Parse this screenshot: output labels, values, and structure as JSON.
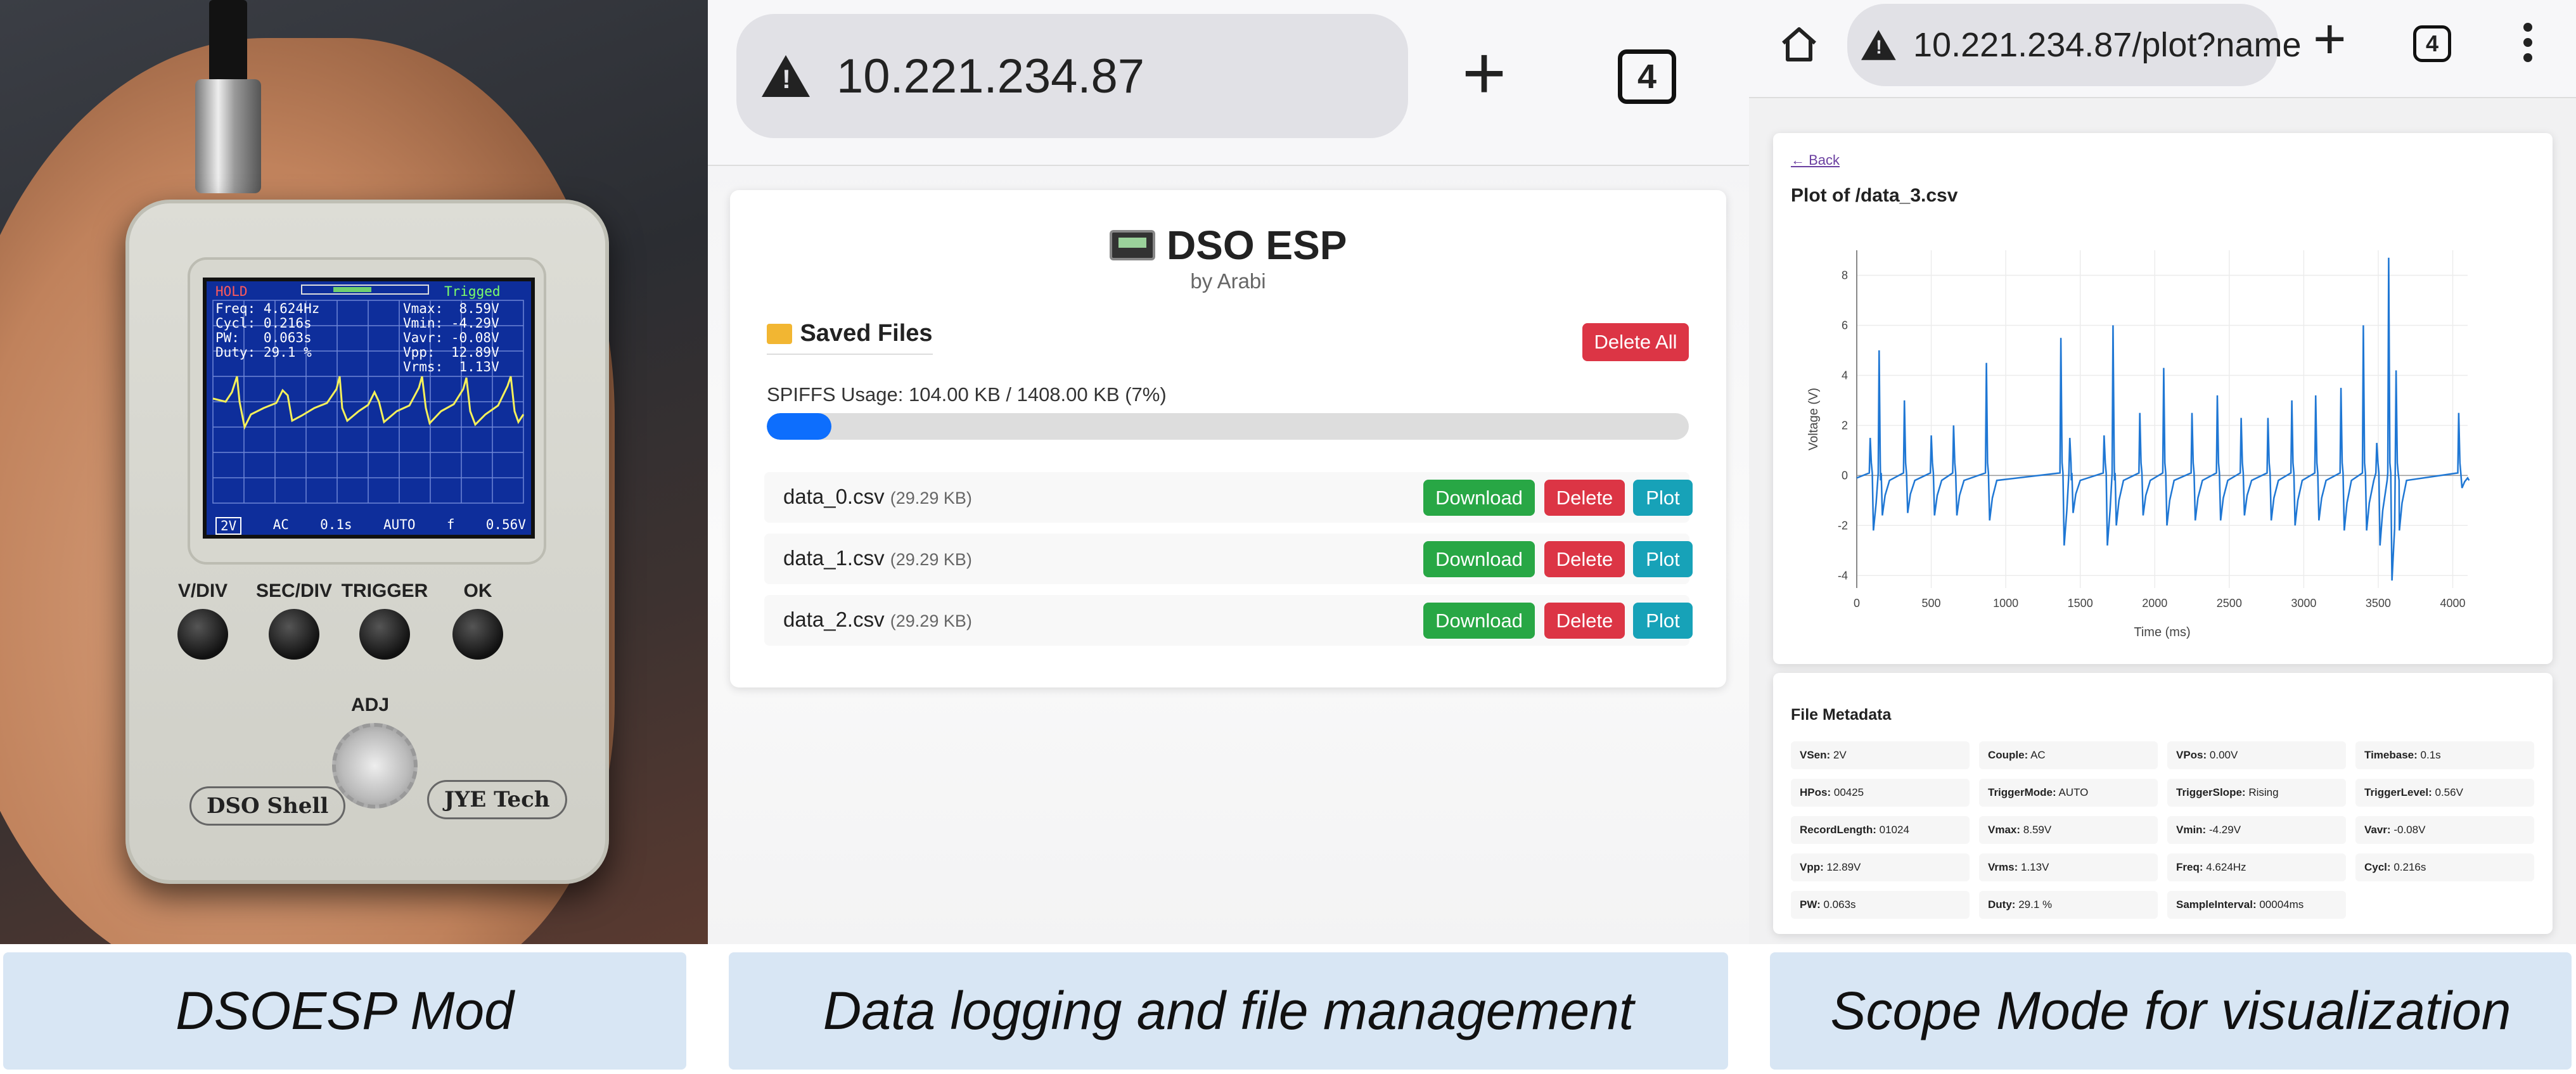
{
  "captions": {
    "left": "DSOESP Mod",
    "middle": "Data logging and file management",
    "right": "Scope Mode for visualization"
  },
  "device": {
    "hold": "HOLD",
    "trig_status": "Trigged",
    "lines_left": [
      "Freq: 4.624Hz",
      "Cycl: 0.216s",
      "PW:   0.063s",
      "Duty: 29.1 %"
    ],
    "lines_right": [
      "Vmax:  8.59V",
      "Vmin: -4.29V",
      "Vavr: -0.08V",
      "Vpp:  12.89V",
      "Vrms:  1.13V"
    ],
    "status_bar": [
      "2V",
      "AC",
      "0.1s",
      "AUTO",
      "f",
      "0.56V"
    ],
    "buttons": [
      "V/DIV",
      "SEC/DIV",
      "TRIGGER",
      "OK"
    ],
    "adj_label": "ADJ",
    "brand_left": "DSO Shell",
    "brand_right": "JYE Tech"
  },
  "browser_mid": {
    "url": "10.221.234.87",
    "tab_count": "4",
    "title": "DSO ESP",
    "subtitle": "by Arabi",
    "section": "Saved Files",
    "delete_all": "Delete All",
    "usage": "SPIFFS Usage: 104.00 KB / 1408.00 KB (7%)",
    "usage_fraction": 0.07,
    "files": [
      {
        "name": "data_0.csv",
        "size": "(29.29 KB)"
      },
      {
        "name": "data_1.csv",
        "size": "(29.29 KB)"
      },
      {
        "name": "data_2.csv",
        "size": "(29.29 KB)"
      }
    ],
    "download_label": "Download",
    "delete_label": "Delete",
    "plot_label": "Plot"
  },
  "browser_right": {
    "url": "10.221.234.87/plot?name",
    "tab_count": "4",
    "back": "← Back",
    "plot_title": "Plot of /data_3.csv",
    "metadata_title": "File Metadata",
    "metadata": [
      [
        "VSen:",
        "2V"
      ],
      [
        "Couple:",
        "AC"
      ],
      [
        "VPos:",
        "0.00V"
      ],
      [
        "Timebase:",
        "0.1s"
      ],
      [
        "HPos:",
        "00425"
      ],
      [
        "TriggerMode:",
        "AUTO"
      ],
      [
        "TriggerSlope:",
        "Rising"
      ],
      [
        "TriggerLevel:",
        "0.56V"
      ],
      [
        "RecordLength:",
        "01024"
      ],
      [
        "Vmax:",
        "8.59V"
      ],
      [
        "Vmin:",
        "-4.29V"
      ],
      [
        "Vavr:",
        "-0.08V"
      ],
      [
        "Vpp:",
        "12.89V"
      ],
      [
        "Vrms:",
        "1.13V"
      ],
      [
        "Freq:",
        "4.624Hz"
      ],
      [
        "Cycl:",
        "0.216s"
      ],
      [
        "PW:",
        "0.063s"
      ],
      [
        "Duty:",
        "29.1 %"
      ],
      [
        "SampleInterval:",
        "00004ms"
      ]
    ]
  },
  "chart_data": {
    "type": "line",
    "xlabel": "Time (ms)",
    "ylabel": "Voltage (V)",
    "xlim": [
      0,
      4100
    ],
    "ylim": [
      -4.5,
      9
    ],
    "xticks": [
      0,
      500,
      1000,
      1500,
      2000,
      2500,
      3000,
      3500,
      4000
    ],
    "yticks": [
      -4,
      -2,
      0,
      2,
      4,
      6,
      8
    ],
    "grid": true,
    "color": "#1f77d4",
    "pulses": [
      {
        "x": 90,
        "peak": 1.5,
        "trough": -2.2
      },
      {
        "x": 150,
        "peak": 5.0,
        "trough": -1.6
      },
      {
        "x": 320,
        "peak": 3.0,
        "trough": -1.5
      },
      {
        "x": 500,
        "peak": 1.6,
        "trough": -1.6
      },
      {
        "x": 650,
        "peak": 2.0,
        "trough": -1.6
      },
      {
        "x": 870,
        "peak": 4.5,
        "trough": -1.8
      },
      {
        "x": 1370,
        "peak": 5.5,
        "trough": -2.8
      },
      {
        "x": 1430,
        "peak": 1.5,
        "trough": -1.5
      },
      {
        "x": 1660,
        "peak": 1.6,
        "trough": -2.8
      },
      {
        "x": 1720,
        "peak": 6.0,
        "trough": -2.0
      },
      {
        "x": 1900,
        "peak": 2.5,
        "trough": -1.6
      },
      {
        "x": 2060,
        "peak": 4.3,
        "trough": -2.0
      },
      {
        "x": 2250,
        "peak": 2.5,
        "trough": -1.8
      },
      {
        "x": 2420,
        "peak": 3.2,
        "trough": -1.8
      },
      {
        "x": 2580,
        "peak": 2.3,
        "trough": -1.6
      },
      {
        "x": 2760,
        "peak": 2.3,
        "trough": -1.8
      },
      {
        "x": 2920,
        "peak": 3.0,
        "trough": -2.0
      },
      {
        "x": 3080,
        "peak": 3.2,
        "trough": -1.8
      },
      {
        "x": 3250,
        "peak": 3.5,
        "trough": -2.2
      },
      {
        "x": 3400,
        "peak": 6.0,
        "trough": -2.2
      },
      {
        "x": 3490,
        "peak": 1.3,
        "trough": -2.8
      },
      {
        "x": 3570,
        "peak": 8.7,
        "trough": -4.2
      },
      {
        "x": 3620,
        "peak": 4.2,
        "trough": -2.2
      },
      {
        "x": 4040,
        "peak": 2.5,
        "trough": -0.5
      }
    ]
  }
}
